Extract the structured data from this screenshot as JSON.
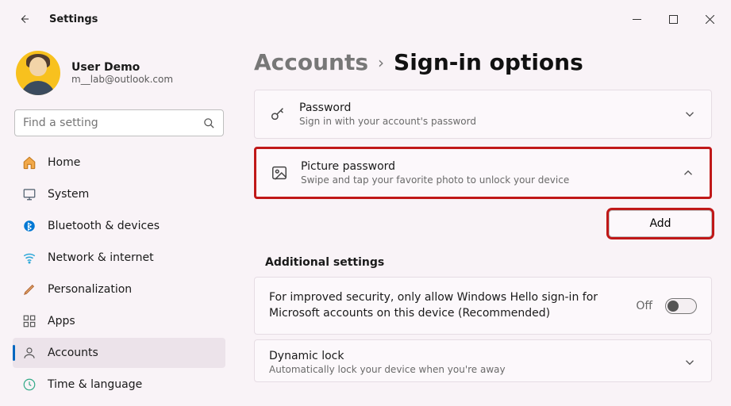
{
  "window": {
    "title": "Settings"
  },
  "profile": {
    "name": "User Demo",
    "email": "m__lab@outlook.com"
  },
  "search": {
    "placeholder": "Find a setting"
  },
  "nav": {
    "items": [
      {
        "label": "Home"
      },
      {
        "label": "System"
      },
      {
        "label": "Bluetooth & devices"
      },
      {
        "label": "Network & internet"
      },
      {
        "label": "Personalization"
      },
      {
        "label": "Apps"
      },
      {
        "label": "Accounts"
      },
      {
        "label": "Time & language"
      }
    ]
  },
  "breadcrumb": {
    "parent": "Accounts",
    "current": "Sign-in options"
  },
  "cards": {
    "password": {
      "title": "Password",
      "sub": "Sign in with your account's password"
    },
    "picture": {
      "title": "Picture password",
      "sub": "Swipe and tap your favorite photo to unlock your device",
      "add": "Add"
    }
  },
  "additional": {
    "heading": "Additional settings",
    "hello": {
      "text": "For improved security, only allow Windows Hello sign-in for Microsoft accounts on this device (Recommended)",
      "state": "Off"
    },
    "dynamic": {
      "title": "Dynamic lock",
      "sub": "Automatically lock your device when you're away"
    }
  }
}
